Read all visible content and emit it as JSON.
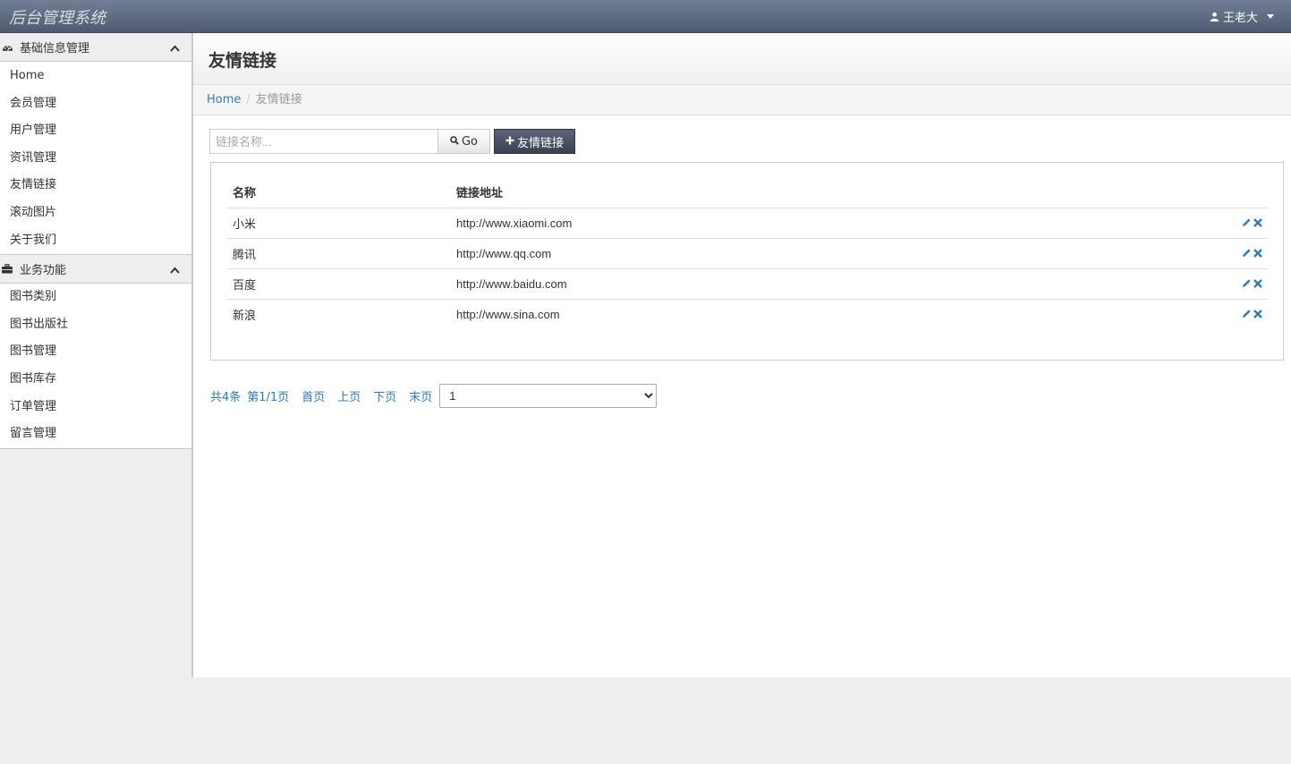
{
  "app": {
    "title": "后台管理系统"
  },
  "user": {
    "name": "王老大",
    "icon": "user-icon"
  },
  "sidebar": {
    "sections": [
      {
        "title": "基础信息管理",
        "icon": "dashboard-icon",
        "items": [
          "Home",
          "会员管理",
          "用户管理",
          "资讯管理",
          "友情链接",
          "滚动图片",
          "关于我们"
        ]
      },
      {
        "title": "业务功能",
        "icon": "briefcase-icon",
        "items": [
          "图书类别",
          "图书出版社",
          "图书管理",
          "图书库存",
          "订单管理",
          "留言管理"
        ]
      }
    ]
  },
  "page": {
    "title": "友情链接",
    "breadcrumb": {
      "home": "Home",
      "current": "友情链接"
    }
  },
  "search": {
    "placeholder": "链接名称...",
    "value": "",
    "go_label": "Go"
  },
  "add_button": {
    "label": "友情链接"
  },
  "table": {
    "headers": [
      "名称",
      "链接地址"
    ],
    "rows": [
      {
        "name": "小米",
        "url": "http://www.xiaomi.com"
      },
      {
        "name": "腾讯",
        "url": "http://www.qq.com"
      },
      {
        "name": "百度",
        "url": "http://www.baidu.com"
      },
      {
        "name": "新浪",
        "url": "http://www.sina.com"
      }
    ]
  },
  "pager": {
    "total": "共4条",
    "page_info": "第1/1页",
    "first": "首页",
    "prev": "上页",
    "next": "下页",
    "last": "末页",
    "selected_page": "1"
  },
  "colors": {
    "navbar": "#5f6b80",
    "link": "#2e7bbf",
    "add_button": "#4a5366"
  }
}
